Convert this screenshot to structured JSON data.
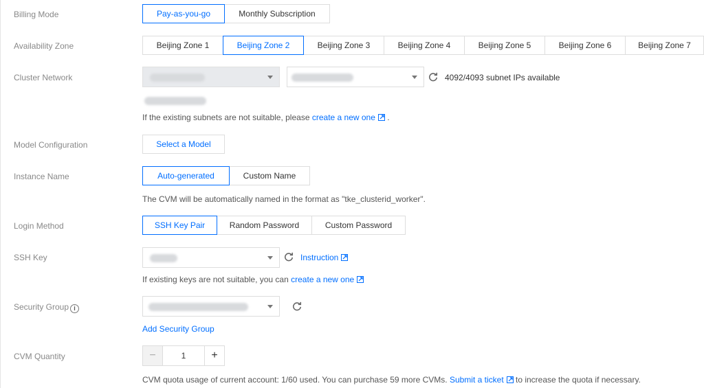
{
  "billing": {
    "label": "Billing Mode",
    "options": [
      "Pay-as-you-go",
      "Monthly Subscription"
    ],
    "selected": 0
  },
  "zone": {
    "label": "Availability Zone",
    "options": [
      "Beijing Zone 1",
      "Beijing Zone 2",
      "Beijing Zone 3",
      "Beijing Zone 4",
      "Beijing Zone 5",
      "Beijing Zone 6",
      "Beijing Zone 7"
    ],
    "selected": 1
  },
  "network": {
    "label": "Cluster Network",
    "ip_available": "4092/4093 subnet IPs available",
    "hint_prefix": "If the existing subnets are not suitable, please",
    "hint_link": "create a new one",
    "hint_suffix": "."
  },
  "model": {
    "label": "Model Configuration",
    "button": "Select a Model"
  },
  "instance": {
    "label": "Instance Name",
    "options": [
      "Auto-generated",
      "Custom Name"
    ],
    "selected": 0,
    "hint": "The CVM will be automatically named in the format as \"tke_clusterid_worker\"."
  },
  "login": {
    "label": "Login Method",
    "options": [
      "SSH Key Pair",
      "Random Password",
      "Custom Password"
    ],
    "selected": 0
  },
  "ssh": {
    "label": "SSH Key",
    "instruction": "Instruction",
    "hint_prefix": "If existing keys are not suitable, you can",
    "hint_link": "create a new one"
  },
  "security": {
    "label": "Security Group",
    "info_icon": "i",
    "add_link": "Add Security Group"
  },
  "quantity": {
    "label": "CVM Quantity",
    "minus": "−",
    "value": "1",
    "plus": "+",
    "hint_prefix": "CVM quota usage of current account: 1/60 used. You can purchase 59 more CVMs.",
    "hint_link": "Submit a ticket",
    "hint_suffix": "to increase the quota if necessary."
  },
  "colors": {
    "accent": "#006eff",
    "label": "#888888",
    "border": "#dddddd"
  }
}
